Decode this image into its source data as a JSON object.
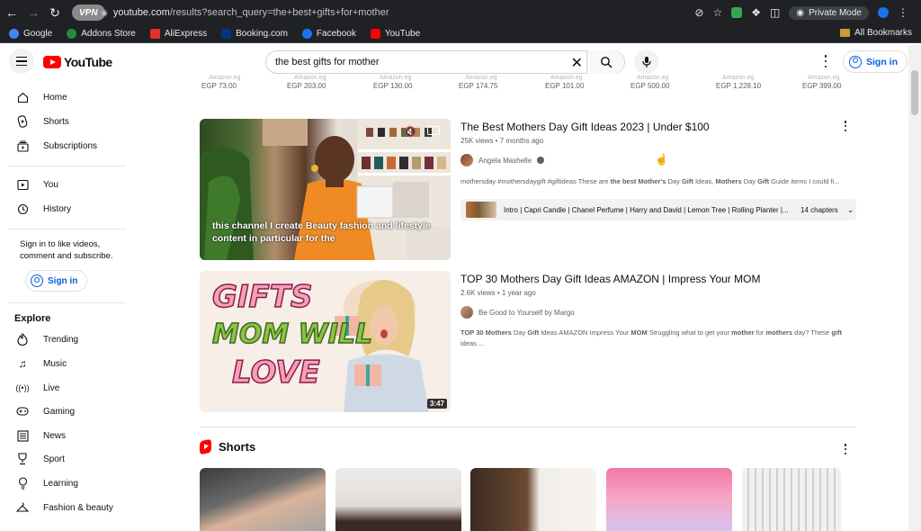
{
  "browser": {
    "vpn_label": "VPN",
    "url_host": "youtube.com",
    "url_path": "/results?search_query=the+best+gifts+for+mother",
    "private_mode": "Private Mode",
    "bookmarks": [
      {
        "label": "Google",
        "color": "#4285f4"
      },
      {
        "label": "Addons Store",
        "color": "#1e8e3e"
      },
      {
        "label": "AliExpress",
        "color": "#e43225"
      },
      {
        "label": "Booking.com",
        "color": "#003580"
      },
      {
        "label": "Facebook",
        "color": "#1877f2"
      },
      {
        "label": "YouTube",
        "color": "#ff0000"
      }
    ],
    "all_bookmarks": "All Bookmarks"
  },
  "header": {
    "logo": "YouTube",
    "search_value": "the best gifts for mother",
    "sign_in": "Sign in"
  },
  "sidebar": {
    "primary": [
      {
        "label": "Home",
        "icon": "home-icon"
      },
      {
        "label": "Shorts",
        "icon": "shorts-icon"
      },
      {
        "label": "Subscriptions",
        "icon": "subscriptions-icon"
      }
    ],
    "secondary": [
      {
        "label": "You",
        "icon": "you-icon"
      },
      {
        "label": "History",
        "icon": "history-icon"
      }
    ],
    "signin_note": "Sign in to like videos, comment and subscribe.",
    "signin_button": "Sign in",
    "explore_title": "Explore",
    "explore": [
      {
        "label": "Trending",
        "icon": "trending-icon"
      },
      {
        "label": "Music",
        "icon": "music-icon"
      },
      {
        "label": "Live",
        "icon": "live-icon"
      },
      {
        "label": "Gaming",
        "icon": "gaming-icon"
      },
      {
        "label": "News",
        "icon": "news-icon"
      },
      {
        "label": "Sport",
        "icon": "sport-icon"
      },
      {
        "label": "Learning",
        "icon": "learning-icon"
      },
      {
        "label": "Fashion & beauty",
        "icon": "fashion-icon"
      }
    ]
  },
  "product_strip": {
    "prices": [
      "EGP 73.00",
      "EGP 203.00",
      "EGP 130.00",
      "EGP 174.75",
      "EGP 101.00",
      "EGP 500.00",
      "EGP 1,228.10",
      "EGP 399.00"
    ],
    "store": "Amazon.eg"
  },
  "videos": [
    {
      "title": "The Best Mothers Day Gift Ideas 2023 | Under $100",
      "meta": "25K views • 7 months ago",
      "channel": "Angela Mashelle",
      "description_html": "mothersday #mothersdaygift #giftideas These are <b>the best Mother's</b> Day <b>Gift</b> Ideas, <b>Mothers</b> Day <b>Gift</b> Guide items I could fi...",
      "caption": "this channel I create Beauty fashion and lifestyle content in particular for the",
      "chapters_text": "Intro | Capri Candle | Chanel Perfume | Harry and David | Lemon Tree | Rolling Planter |...",
      "chapters_count": "14 chapters"
    },
    {
      "title": "TOP 30 Mothers Day Gift Ideas AMAZON | Impress Your MOM",
      "meta": "2.6K views • 1 year ago",
      "channel": "Be Good to Yourself by Margo",
      "description_html": "<b>TOP 30 Mothers</b> Day <b>Gift</b> Ideas AMAZON Impress Your <b>MOM</b> Struggling what to get your <b>mother</b> for <b>mothers</b> day? These <b>gift</b> ideas ...",
      "thumb_lines": [
        "GIFTS",
        "MOM WILL",
        "LOVE"
      ],
      "duration": "3:47"
    }
  ],
  "shorts": {
    "title": "Shorts"
  }
}
